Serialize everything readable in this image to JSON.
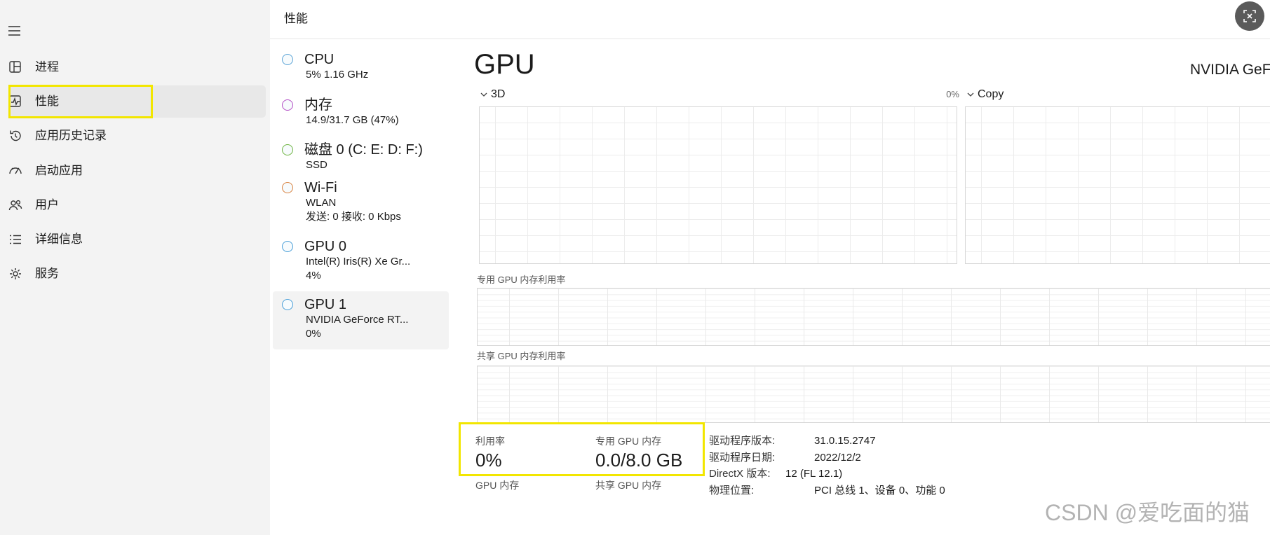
{
  "header": {
    "title": "性能"
  },
  "sidebar": {
    "items": [
      {
        "label": "进程",
        "icon": "processes-icon"
      },
      {
        "label": "性能",
        "icon": "performance-icon",
        "selected": true
      },
      {
        "label": "应用历史记录",
        "icon": "app-history-icon"
      },
      {
        "label": "启动应用",
        "icon": "startup-apps-icon"
      },
      {
        "label": "用户",
        "icon": "users-icon"
      },
      {
        "label": "详细信息",
        "icon": "details-icon"
      },
      {
        "label": "服务",
        "icon": "services-icon"
      }
    ]
  },
  "devices": [
    {
      "name": "CPU",
      "sub": [
        "5% 1.16 GHz"
      ],
      "color": "#5aa3d6"
    },
    {
      "name": "内存",
      "sub": [
        "14.9/31.7 GB (47%)"
      ],
      "color": "#b24cc4"
    },
    {
      "name": "磁盘 0 (C: E: D: F:)",
      "sub": [
        "SSD"
      ],
      "color": "#6db33f"
    },
    {
      "name": "Wi-Fi",
      "sub": [
        "WLAN",
        "发送: 0 接收: 0 Kbps"
      ],
      "color": "#d9823f"
    },
    {
      "name": "GPU 0",
      "sub": [
        "Intel(R) Iris(R) Xe Gr...",
        "4%"
      ],
      "color": "#4a9fd8"
    },
    {
      "name": "GPU 1",
      "sub": [
        "NVIDIA GeForce RT...",
        "0%"
      ],
      "color": "#4a9fd8",
      "selected": true
    }
  ],
  "gpu": {
    "title": "GPU",
    "model": "NVIDIA GeF",
    "engine1": {
      "label": "3D",
      "value": "0%"
    },
    "engine2": {
      "label": "Copy"
    },
    "dedicated_chart_label": "专用 GPU 内存利用率",
    "shared_chart_label": "共享 GPU 内存利用率",
    "stats": {
      "utilization_label": "利用率",
      "utilization_value": "0%",
      "dedicated_label": "专用 GPU 内存",
      "dedicated_value": "0.0/8.0 GB",
      "gpu_memory_label": "GPU 内存",
      "shared_label": "共享 GPU 内存"
    },
    "info": [
      {
        "label": "驱动程序版本:",
        "value": "31.0.15.2747"
      },
      {
        "label": "驱动程序日期:",
        "value": "2022/12/2"
      },
      {
        "label": "DirectX 版本:",
        "value": "12 (FL 12.1)"
      },
      {
        "label": "物理位置:",
        "value": "PCI 总线 1、设备 0、功能 0"
      }
    ]
  },
  "annotation_color": "#f2e600",
  "watermark": "CSDN @爱吃面的猫"
}
